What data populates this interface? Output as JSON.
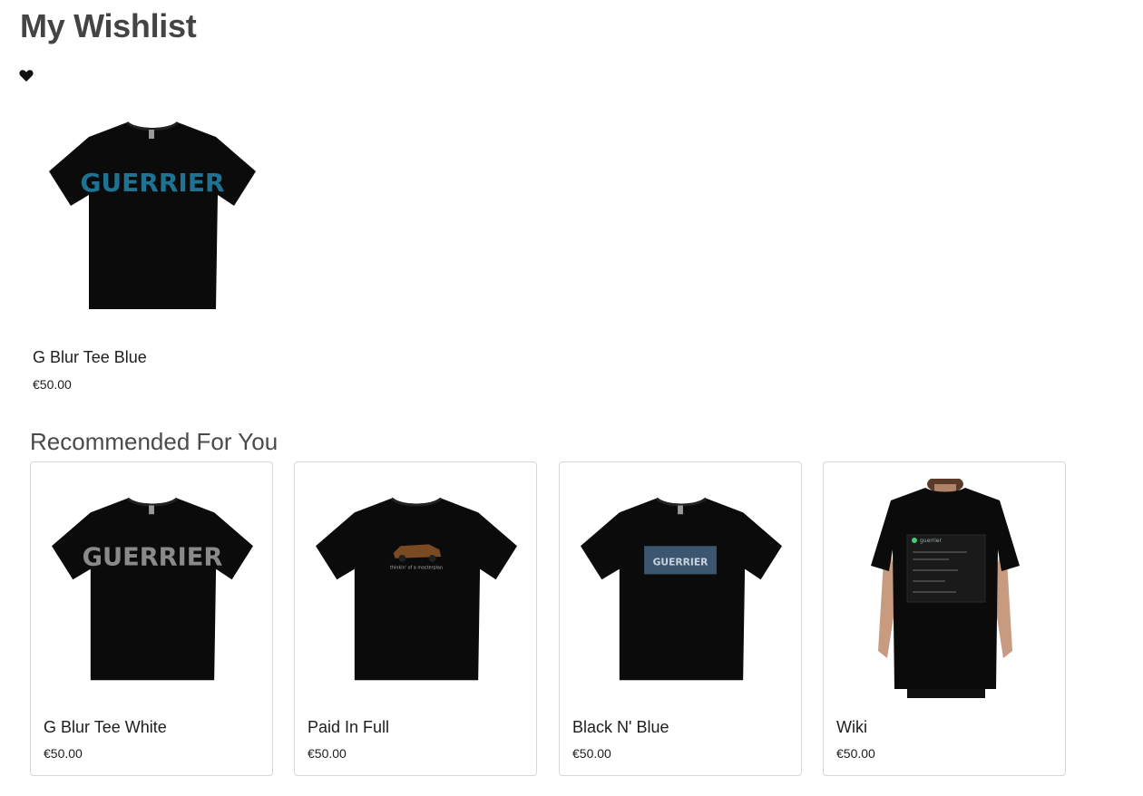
{
  "page": {
    "title": "My Wishlist",
    "heart_icon": "heart-icon"
  },
  "wishlist": [
    {
      "name": "G Blur Tee Blue",
      "price": "€50.00",
      "print": "GUERRIER",
      "print_color": "#1f7fa0"
    }
  ],
  "recommended": {
    "title": "Recommended For You",
    "items": [
      {
        "name": "G Blur Tee White",
        "price": "€50.00",
        "print": "GUERRIER",
        "print_color": "#8a8a8a"
      },
      {
        "name": "Paid In Full",
        "price": "€50.00",
        "print": "thinkin' of a masterplan",
        "print_color": "#b07a3a"
      },
      {
        "name": "Black N' Blue",
        "price": "€50.00",
        "print": "GUERRIER",
        "print_color": "#c9d3dd"
      },
      {
        "name": "Wiki",
        "price": "€50.00",
        "print": "guerrier",
        "print_color": "#9aa"
      }
    ]
  }
}
